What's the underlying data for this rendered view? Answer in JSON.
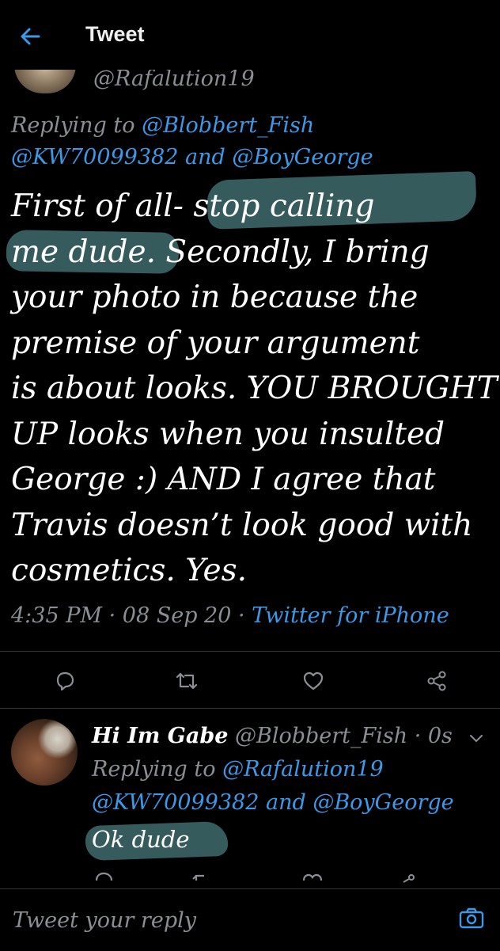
{
  "header": {
    "title": "Tweet",
    "back_icon": "back-arrow-icon"
  },
  "tweet": {
    "handle": "@Rafalution19",
    "replying_prefix": "Replying to ",
    "replying_to_1": "@Blobbert_Fish",
    "replying_to_2": "@KW70099382",
    "replying_and": " and ",
    "replying_to_3": "@BoyGeorge",
    "lines": [
      "First of all- stop calling",
      "me dude. Secondly, I bring",
      "your photo in because the",
      "premise of your argument",
      "is about looks. YOU BROUGHT",
      "UP looks when you insulted",
      "George :) AND I agree that",
      "Travis doesn’t look good with",
      "cosmetics. Yes."
    ],
    "time": "4:35 PM",
    "sep": " · ",
    "date": "08 Sep 20",
    "source": "Twitter for iPhone"
  },
  "actions": [
    "reply-icon",
    "retweet-icon",
    "like-icon",
    "share-icon"
  ],
  "reply": {
    "name": "Hi Im Gabe",
    "handle": " @Blobbert_Fish",
    "dot": " · ",
    "age": "0s",
    "replying_prefix": "Replying to ",
    "replying_to_1": "@Rafalution19",
    "replying_to_2": "@KW70099382",
    "replying_and": " and ",
    "replying_to_3": "@BoyGeorge",
    "text": "Ok dude"
  },
  "reply_bar": {
    "placeholder": "Tweet your reply",
    "camera_icon": "camera-icon"
  },
  "colors": {
    "background": "#000000",
    "link": "#3b99e8",
    "muted": "#8a8f94",
    "highlight": "#3f6b6d"
  }
}
